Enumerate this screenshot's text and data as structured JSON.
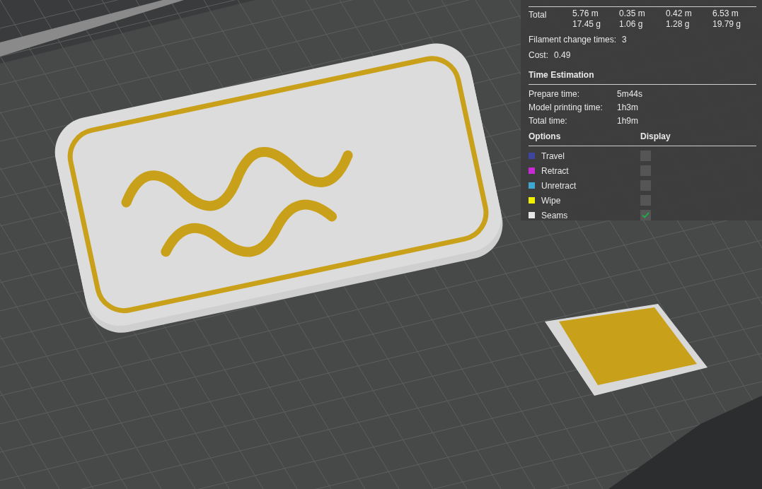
{
  "stats": {
    "total": {
      "label": "Total",
      "lengths": [
        "5.76 m",
        "0.35 m",
        "0.42 m",
        "6.53 m"
      ],
      "weights": [
        "17.45 g",
        "1.06 g",
        "1.28 g",
        "19.79 g"
      ]
    },
    "filament_change": {
      "label": "Filament change times:",
      "value": "3"
    },
    "cost": {
      "label": "Cost:",
      "value": "0.49"
    }
  },
  "time_estimation": {
    "title": "Time Estimation",
    "rows": [
      {
        "label": "Prepare time:",
        "value": "5m44s"
      },
      {
        "label": "Model printing time:",
        "value": "1h3m"
      },
      {
        "label": "Total time:",
        "value": "1h9m"
      }
    ]
  },
  "options": {
    "title": "Options",
    "display_header": "Display",
    "items": [
      {
        "label": "Travel",
        "color": "#3d45a0",
        "checked": false
      },
      {
        "label": "Retract",
        "color": "#c72ad6",
        "checked": false
      },
      {
        "label": "Unretract",
        "color": "#40a8d0",
        "checked": false
      },
      {
        "label": "Wipe",
        "color": "#f0f000",
        "checked": false
      },
      {
        "label": "Seams",
        "color": "#e6e6e6",
        "checked": true
      }
    ]
  }
}
